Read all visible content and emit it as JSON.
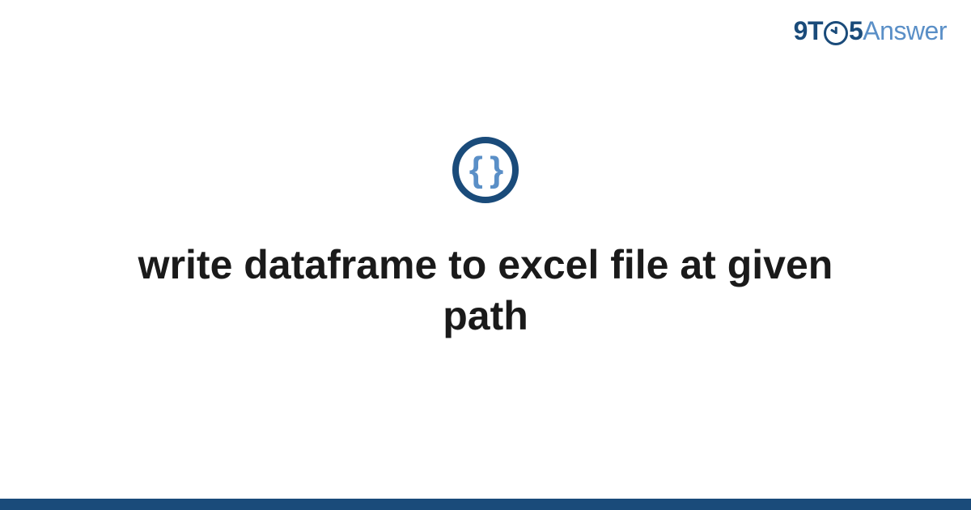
{
  "brand": {
    "part1": "9T",
    "part2": "5",
    "part3": "Answer"
  },
  "icon": {
    "glyph": "{ }",
    "name": "code-braces-icon"
  },
  "title": "write dataframe to excel file at given path",
  "colors": {
    "primary": "#1a4b7a",
    "secondary": "#5a8fc7"
  }
}
